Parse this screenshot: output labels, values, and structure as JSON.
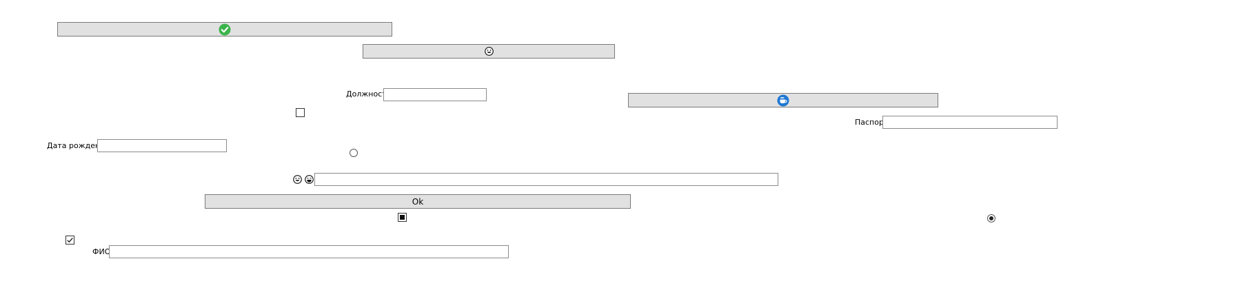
{
  "buttons": {
    "ok_label": "Ok"
  },
  "fields": {
    "position_label": "Должность",
    "position_value": "",
    "passport_label": "Паспорт",
    "passport_value": "",
    "birthdate_label": "Дата рождения",
    "birthdate_value": "",
    "fio_label": "ФИО",
    "fio_value": "",
    "emoji_field_value": ""
  },
  "checkboxes": {
    "unchecked_box": false,
    "indeterminate_box": "indeterminate",
    "checked_box": true
  },
  "radios": {
    "radio_left_selected": false,
    "radio_right_selected": true
  },
  "icons": {
    "check_circle": "check-circle-icon",
    "grin_face": "grin-face-icon",
    "cup_badge": "cup-badge-icon",
    "grin_face_small": "grin-face-icon",
    "laugh_face_small": "laugh-face-icon"
  },
  "colors": {
    "button_bg": "#e1e1e1",
    "check_green": "#3cb44b",
    "badge_blue": "#1e78d2"
  }
}
